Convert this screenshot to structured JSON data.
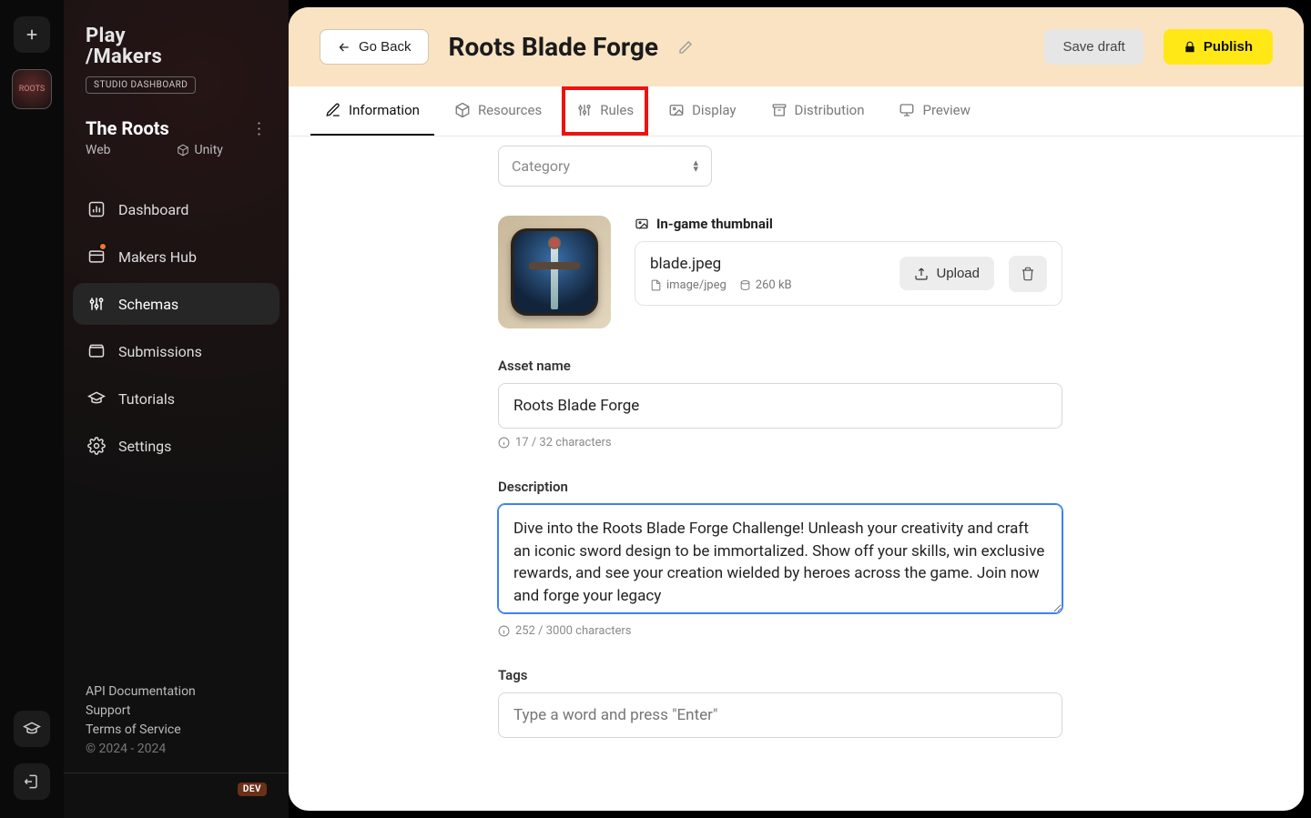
{
  "brand": {
    "line1": "Play",
    "line2": "/Makers",
    "badge": "STUDIO DASHBOARD"
  },
  "project": {
    "title": "The Roots",
    "platform": "Web",
    "engine": "Unity"
  },
  "sidebar": {
    "items": [
      {
        "label": "Dashboard"
      },
      {
        "label": "Makers Hub"
      },
      {
        "label": "Schemas"
      },
      {
        "label": "Submissions"
      },
      {
        "label": "Tutorials"
      },
      {
        "label": "Settings"
      }
    ],
    "footer": {
      "api": "API Documentation",
      "support": "Support",
      "tos": "Terms of Service",
      "copyright": "© 2024 - 2024",
      "dev": "DEV"
    }
  },
  "header": {
    "back": "Go Back",
    "title": "Roots Blade Forge",
    "draft": "Save draft",
    "publish": "Publish"
  },
  "tabs": [
    {
      "label": "Information"
    },
    {
      "label": "Resources"
    },
    {
      "label": "Rules"
    },
    {
      "label": "Display"
    },
    {
      "label": "Distribution"
    },
    {
      "label": "Preview"
    }
  ],
  "form": {
    "category": {
      "placeholder": "Category"
    },
    "thumbnail": {
      "label": "In-game thumbnail",
      "filename": "blade.jpeg",
      "mimetype": "image/jpeg",
      "size": "260 kB",
      "upload": "Upload"
    },
    "asset_name": {
      "label": "Asset name",
      "value": "Roots Blade Forge",
      "helper": "17 / 32 characters"
    },
    "description": {
      "label": "Description",
      "value": "Dive into the Roots Blade Forge Challenge! Unleash your creativity and craft an iconic sword design to be immortalized. Show off your skills, win exclusive rewards, and see your creation wielded by heroes across the game. Join now and forge your legacy",
      "helper": "252 / 3000 characters"
    },
    "tags": {
      "label": "Tags",
      "placeholder": "Type a word and press \"Enter\""
    }
  }
}
